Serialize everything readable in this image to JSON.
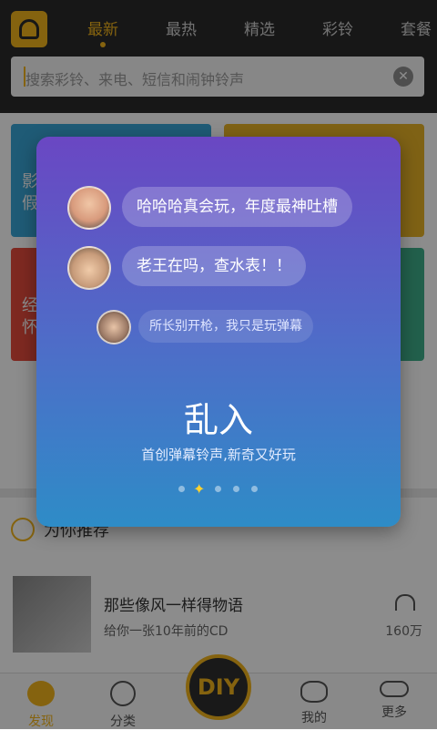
{
  "tabs": [
    "最新",
    "最热",
    "精选",
    "彩铃",
    "套餐"
  ],
  "search": {
    "placeholder": "搜索彩铃、来电、短信和闹钟铃声",
    "clear_icon": "✕"
  },
  "background_cards": [
    {
      "text": "影\n假",
      "color": "#3aa6d8"
    },
    {
      "text": "",
      "color": "#e7b227"
    },
    {
      "text": "经\n怀",
      "color": "#e64b3c"
    },
    {
      "text": "",
      "color": "#3fb08b"
    }
  ],
  "recommend": {
    "title": "为你推荐",
    "song": {
      "title": "那些像风一样得物语",
      "subtitle": "给你一张10年前的CD",
      "count": "160万"
    }
  },
  "bottom_nav": {
    "items": [
      {
        "label": "发现",
        "active": true
      },
      {
        "label": "分类",
        "active": false
      },
      {
        "label": "我的",
        "active": false
      },
      {
        "label": "更多",
        "active": false
      }
    ],
    "center_label": "DIY"
  },
  "modal": {
    "messages": [
      {
        "text": "哈哈哈真会玩，年度最神吐槽"
      },
      {
        "text": "老王在吗，查水表！！"
      },
      {
        "text": "所长别开枪，我只是玩弹幕"
      }
    ],
    "title": "乱入",
    "subtitle": "首创弹幕铃声,新奇又好玩",
    "pager": {
      "count": 5,
      "active_index": 1
    }
  },
  "colors": {
    "accent": "#f3b51d",
    "topbar": "#2b2b2b",
    "modal_top": "#6a47c3",
    "modal_bottom": "#2e8cc7"
  }
}
